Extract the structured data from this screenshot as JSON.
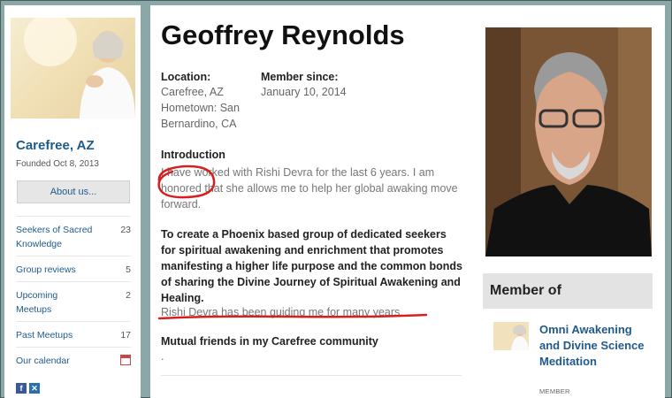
{
  "sidebar": {
    "group_name": "Carefree, AZ",
    "founded": "Founded Oct 8, 2013",
    "about_button": "About us...",
    "nav": [
      {
        "label": "Seekers of Sacred Knowledge",
        "count": "23"
      },
      {
        "label": "Group reviews",
        "count": "5"
      },
      {
        "label": "Upcoming Meetups",
        "count": "2"
      },
      {
        "label": "Past Meetups",
        "count": "17"
      },
      {
        "label": "Our calendar",
        "icon": "calendar-icon"
      }
    ],
    "social": [
      {
        "icon": "facebook-icon",
        "glyph": "f",
        "color": "#3b5998"
      },
      {
        "icon": "share-icon",
        "glyph": "✕",
        "color": "#2a6fb5"
      }
    ]
  },
  "profile": {
    "name": "Geoffrey Reynolds",
    "location_label": "Location:",
    "location_value": "Carefree, AZ",
    "hometown": "Hometown: San Bernardino, CA",
    "member_since_label": "Member since:",
    "member_since_value": "January 10, 2014",
    "intro_label": "Introduction",
    "intro_text": "I have worked with Rishi Devra for the last 6 years. I am honored that she allows me to help her global awaking move forward.",
    "mission_text": "To create a Phoenix based group of dedicated seekers for spiritual awakening and enrichment that promotes manifesting a higher life purpose and the common bonds of sharing the Divine Journey of Spiritual Awakening and Healing.",
    "guiding_text": "Rishi Devra has been guiding me for many years.",
    "mutual_label": "Mutual friends in my Carefree community",
    "mutual_value": "."
  },
  "member_of": {
    "title": "Member of",
    "group_name": "Omni Awakening and Divine Science Meditation",
    "role": "MEMBER"
  },
  "colors": {
    "link": "#1f5a8c",
    "annotation": "#d62020",
    "page_bg": "#8aa8a8"
  }
}
